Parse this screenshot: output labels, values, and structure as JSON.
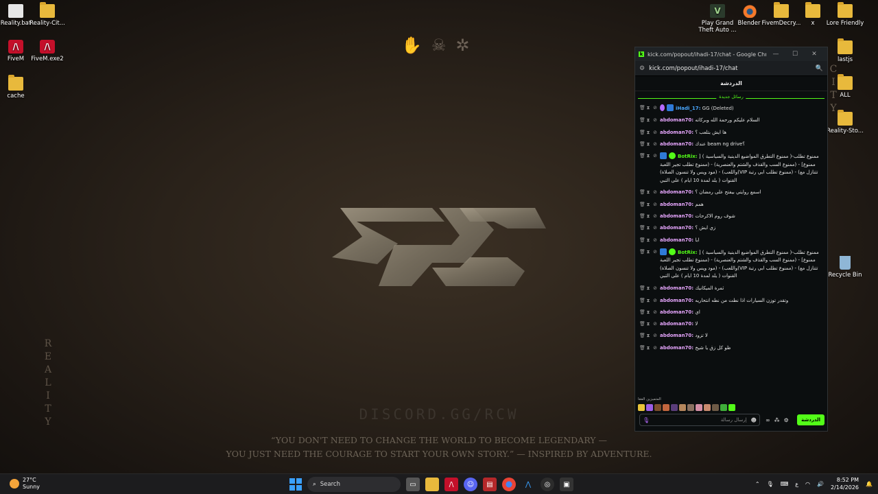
{
  "desktop": {
    "left_icons": [
      {
        "label": "Reality.bat",
        "icon": "batch-file-icon"
      },
      {
        "label": "Reality-Cit...",
        "icon": "folder-icon"
      },
      {
        "label": "FiveM",
        "icon": "fivem-icon"
      },
      {
        "label": "FiveM.exe2",
        "icon": "fivem-icon"
      },
      {
        "label": "cache",
        "icon": "folder-icon"
      }
    ],
    "right_icons": [
      {
        "label": "Play Grand Theft Auto ...",
        "icon": "gta-icon"
      },
      {
        "label": "Blender",
        "icon": "blender-icon"
      },
      {
        "label": "FivemDecry...",
        "icon": "folder-icon"
      },
      {
        "label": "x",
        "icon": "folder-icon"
      },
      {
        "label": "Lore Friendly",
        "icon": "folder-icon"
      },
      {
        "label": "lastjs",
        "icon": "folder-icon"
      },
      {
        "label": "ALL",
        "icon": "folder-icon"
      },
      {
        "label": "Reality-Sto...",
        "icon": "folder-icon"
      },
      {
        "label": "Recycle Bin",
        "icon": "recycle-bin-icon"
      }
    ],
    "wallpaper": {
      "discord": "DISCORD.GG/RCW",
      "quote_line1": "“YOU DON'T NEED TO CHANGE THE WORLD TO BECOME LEGENDARY —",
      "quote_line2": "YOU JUST NEED THE COURAGE TO START YOUR OWN STORY.” — INSPIRED BY ADVENTURE.",
      "side_text": "REALITY"
    }
  },
  "chrome": {
    "title": "kick.com/popout/ihadi-17/chat - Google Chrome",
    "url": "kick.com/popout/ihadi-17/chat",
    "minimize": "—",
    "maximize": "☐",
    "close": "✕"
  },
  "chat": {
    "header": "الدردشة",
    "new_messages_label": "رسائل جديدة",
    "messages": [
      {
        "user": "iHadi_17:",
        "text": "GG (Deleted)",
        "style": "blue"
      },
      {
        "user": "abdoman70:",
        "text": "السلام عليكم ورحمة الله وبركاته",
        "style": "pink"
      },
      {
        "user": "abdoman70:",
        "text": "ها ايش بتلعب ؟",
        "style": "pink"
      },
      {
        "user": "abdoman70:",
        "text": "عندك beam ng drive؟",
        "style": "pink"
      },
      {
        "user": "BotRix:",
        "text": "ممنوع تطلب-( ممنوع التطرق المواضيع الدينية والسياسية ) [ ممنوع] - (ممنوع السب والقذف والشتم والعنصرية) - (ممنوع تطلب تجير اللعبة واللعب) - (مود ويس ولا تنسون الصلاة)(VIP ممنوع تطلب ابي رتبة) - (تتنازل مع القنوات ( يلد لمدة 10 ايام ) على التبي",
        "style": "green"
      },
      {
        "user": "abdoman70:",
        "text": "اسمع روايتي بيفتح على رمضان ؟",
        "style": "pink"
      },
      {
        "user": "abdoman70:",
        "text": "همم",
        "style": "pink"
      },
      {
        "user": "abdoman70:",
        "text": "شوف روم الاكرحات",
        "style": "pink"
      },
      {
        "user": "abdoman70:",
        "text": "زي ايش ؟",
        "style": "pink"
      },
      {
        "user": "abdoman70:",
        "text": "ابا",
        "style": "pink"
      },
      {
        "user": "BotRix:",
        "text": "ممنوع تطلب-( ممنوع التطرق المواضيع الدينية والسياسية ) [ ممنوع] - (ممنوع السب والقذف والشتم والعنصرية) - (ممنوع تطلب تجير اللعبة واللعب) - (مود ويس ولا تنسون الصلاة)(VIP ممنوع تطلب ابي رتبة) - (تتنازل مع القنوات ( يلد لمدة 10 ايام ) على التبي",
        "style": "green"
      },
      {
        "user": "abdoman70:",
        "text": "ثمرة الميكانيك",
        "style": "pink"
      },
      {
        "user": "abdoman70:",
        "text": "وتقدر توزن السيارات اذا نطت من نطه انتحاريه",
        "style": "pink"
      },
      {
        "user": "abdoman70:",
        "text": "اي",
        "style": "pink"
      },
      {
        "user": "abdoman70:",
        "text": "لا",
        "style": "pink"
      },
      {
        "user": "abdoman70:",
        "text": "لا تزود",
        "style": "pink"
      },
      {
        "user": "abdoman70:",
        "text": "ظو كل زق يا شيخ",
        "style": "pink"
      }
    ],
    "emotes_label": "المتميزين الفقا",
    "input_placeholder": "إرسال رسالة",
    "send_label": "الدردشة"
  },
  "taskbar": {
    "weather_temp": "27°C",
    "weather_desc": "Sunny",
    "search_label": "Search",
    "time": "8:52 PM",
    "date": "2/14/2026",
    "lang": "ع"
  },
  "colors": {
    "kick_green": "#53fc18",
    "user_pink": "#e7a6ff",
    "user_blue": "#4aa8ff"
  }
}
